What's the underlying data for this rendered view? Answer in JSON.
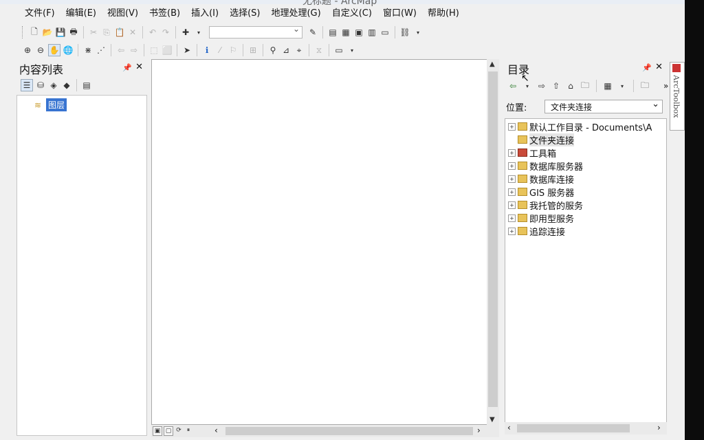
{
  "window": {
    "title": "无标题 - ArcMap"
  },
  "menu": [
    "文件(F)",
    "编辑(E)",
    "视图(V)",
    "书签(B)",
    "插入(I)",
    "选择(S)",
    "地理处理(G)",
    "自定义(C)",
    "窗口(W)",
    "帮助(H)"
  ],
  "toolbar": {
    "scale_value": ""
  },
  "toc": {
    "title": "内容列表",
    "layer_label": "图层"
  },
  "catalog": {
    "title": "目录",
    "location_label": "位置:",
    "location_value": "文件夹连接",
    "tree": [
      {
        "label": "默认工作目录 - Documents\\A",
        "expand": "+"
      },
      {
        "label": "文件夹连接",
        "expand": ""
      },
      {
        "label": "工具箱",
        "expand": "+"
      },
      {
        "label": "数据库服务器",
        "expand": "+"
      },
      {
        "label": "数据库连接",
        "expand": "+"
      },
      {
        "label": "GIS 服务器",
        "expand": "+"
      },
      {
        "label": "我托管的服务",
        "expand": "+"
      },
      {
        "label": "即用型服务",
        "expand": "+"
      },
      {
        "label": "追踪连接",
        "expand": "+"
      }
    ]
  },
  "side_tab": {
    "label": "ArcToolbox"
  },
  "icons": {
    "pin": "📌",
    "close": "✕",
    "more": "»"
  }
}
